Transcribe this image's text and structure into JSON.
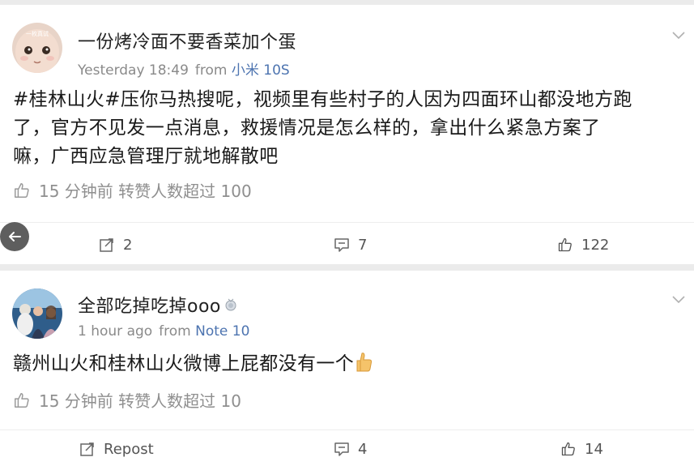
{
  "posts": [
    {
      "username": "一份烤冷面不要香菜加个蛋",
      "avatar_caption": "一枚真试",
      "time": "Yesterday 18:49",
      "from_label": "from",
      "device": "小米 10S",
      "text_lines": [
        "#桂林山火#压你马热搜呢，视频里有些村子的人因为四面环山都没地方跑",
        "了，官方不见发一点消息，救援情况是怎么样的，拿出什么紧急方案了",
        "嘛，广西应急管理厅就地解散吧"
      ],
      "like_note": "15 分钟前 转赞人数超过 100",
      "repost": "2",
      "comments": "7",
      "likes": "122"
    },
    {
      "username": "全部吃掉吃掉ooo",
      "time": "1 hour ago",
      "from_label": "from",
      "device": "Note 10",
      "text": "赣州山火和桂林山火微博上屁都没有一个",
      "like_note": "15 分钟前 转赞人数超过 10",
      "repost": "Repost",
      "comments": "4",
      "likes": "14"
    }
  ],
  "icons": [
    "chevron-down-icon",
    "thumbs-up-icon",
    "repost-icon",
    "comment-icon",
    "back-arrow-icon",
    "thumbs-up-emoji",
    "user-badge-icon"
  ],
  "colors": {
    "device_link": "#4d74b0",
    "meta": "#8a8a8a",
    "separator": "#ebebeb"
  }
}
